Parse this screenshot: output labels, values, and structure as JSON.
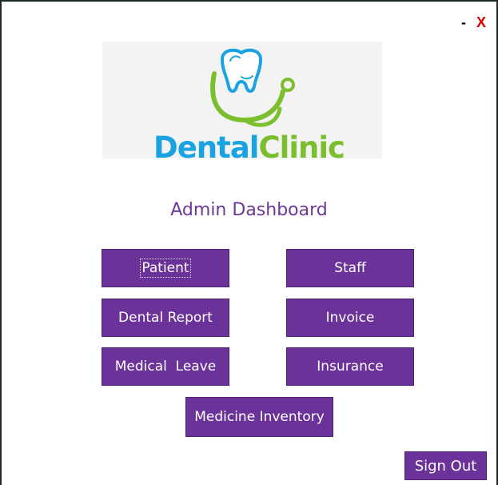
{
  "window": {
    "minimize_label": "-",
    "close_label": "X"
  },
  "logo": {
    "brand_part1": "Dental",
    "brand_part2": "Clinic",
    "colors": {
      "dental": "#1aa3e0",
      "clinic": "#7cbf2e"
    },
    "icon": "tooth-stethoscope-icon"
  },
  "dashboard": {
    "title": "Admin Dashboard",
    "buttons": {
      "patient": "Patient",
      "staff": "Staff",
      "dental_report": "Dental Report",
      "invoice": "Invoice",
      "medical_leave": "Medical  Leave",
      "insurance": "Insurance",
      "medicine_inventory": "Medicine Inventory"
    },
    "sign_out": "Sign Out"
  },
  "colors": {
    "button_bg": "#6b3399",
    "title_color": "#6b3799",
    "close_color": "#d40000"
  }
}
